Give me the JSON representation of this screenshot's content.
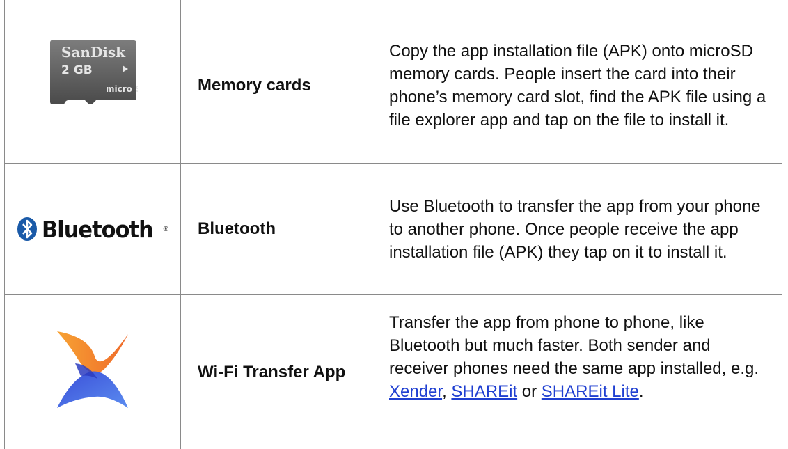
{
  "rows": [
    {
      "icon": "microsd-card-icon",
      "icon_text": {
        "brand": "SanDisk",
        "capacity": "2 GB",
        "type": "micro SD"
      },
      "name": "Memory cards",
      "description": "Copy the app installation file (APK) onto microSD memory cards. People insert the card into their phone’s memory card slot, find the APK file using a file explorer app and tap on the file to install it."
    },
    {
      "icon": "bluetooth-logo-icon",
      "icon_text": {
        "wordmark": "Bluetooth",
        "registered": "®"
      },
      "name": "Bluetooth",
      "description": "Use Bluetooth to transfer the app from your phone to another phone. Once people receive the app installation file (APK) they tap on it to install it."
    },
    {
      "icon": "xender-logo-icon",
      "name": "Wi-Fi Transfer App",
      "description_prefix": "Transfer the app from phone to phone, like Bluetooth but much faster. Both sender and receiver phones need the same app installed, e.g. ",
      "links": [
        "Xender",
        "SHAREit",
        "SHAREit Lite"
      ],
      "separator_1": ", ",
      "separator_2": " or ",
      "description_suffix": "."
    }
  ],
  "colors": {
    "border": "#8a8a8a",
    "link": "#1f3fd1",
    "bluetooth_blue": "#1a5aa8"
  }
}
